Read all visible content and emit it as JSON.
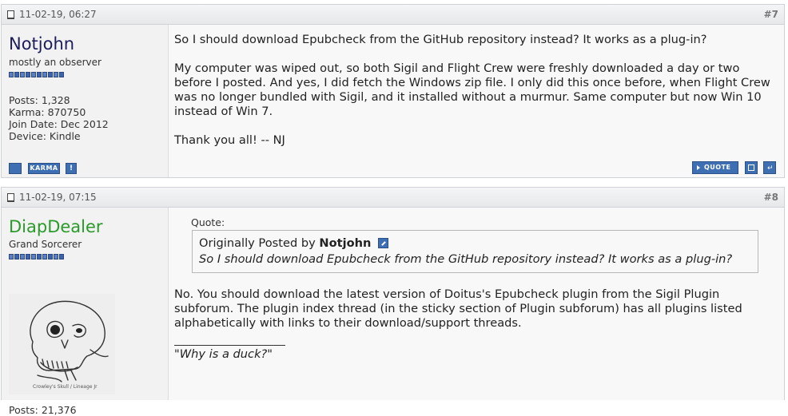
{
  "posts": [
    {
      "date": "11-02-19, 06:27",
      "number": "#7",
      "username": "Notjohn",
      "user_title": "mostly an observer",
      "rep_count": 10,
      "stats": {
        "posts": "Posts: 1,328",
        "karma": "Karma: 870750",
        "join_date": "Join Date: Dec 2012",
        "device": "Device: Kindle"
      },
      "karma_button": "KARMA",
      "report_button": "!",
      "quote_button": "QUOTE",
      "message": [
        "So I should download Epubcheck from the GitHub repository instead? It works as a plug-in?",
        "My computer was wiped out, so both Sigil and Flight Crew were freshly downloaded a day or two before I posted. And yes, I did fetch the Windows zip file. I only did this once before, when Flight Crew was no longer bundled with Sigil, and it installed without a murmur. Same computer but now Win 10 instead of Win 7.",
        "Thank you all! -- NJ"
      ]
    },
    {
      "date": "11-02-19, 07:15",
      "number": "#8",
      "username": "DiapDealer",
      "user_title": "Grand Sorcerer",
      "rep_count": 10,
      "stats": {
        "posts": "Posts: 21,376"
      },
      "avatar": {
        "caption": "Crowley's Skull / Lineage Jr"
      },
      "quote": {
        "label": "Quote:",
        "by_prefix": "Originally Posted by",
        "by_user": "Notjohn",
        "text": "So I should download Epubcheck from the GitHub repository instead? It works as a plug-in?"
      },
      "message": [
        "No. You should download the latest version of Doitus's Epubcheck plugin from the Sigil Plugin subforum. The plugin index thread (in the sticky section of Plugin subforum) has all plugins listed alphabetically with links to their download/support threads."
      ],
      "signature": "\"Why is a duck?\""
    }
  ],
  "colors": {
    "accent": "#3e6fb3",
    "username_dark": "#1d1d5c",
    "username_green": "#2a9a2a",
    "header_bg": "#e6e8ea"
  }
}
